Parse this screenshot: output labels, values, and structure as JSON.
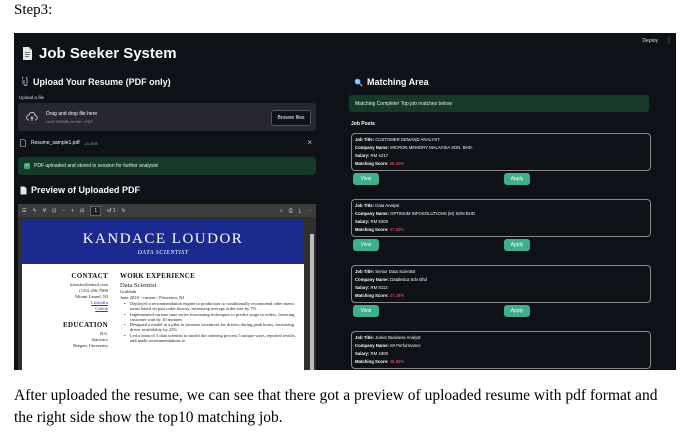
{
  "step_label": "Step3:",
  "app": {
    "deploy": "Deploy",
    "menu_glyph": "⋮",
    "title": "Job Seeker System",
    "upload": {
      "heading": "Upload Your Resume (PDF only)",
      "label": "Upload a file",
      "dropzone_title": "Drag and drop file here",
      "dropzone_limit": "Limit 200MB per file • PDF",
      "browse_label": "Browse files",
      "file_name": "Resume_sample1.pdf",
      "file_size": "21.2KB",
      "success": "PDF uploaded and stored in session for further analysis!"
    },
    "preview": {
      "heading": "Preview of Uploaded PDF",
      "page_current": "1",
      "page_total": "of 1",
      "resume": {
        "name": "KANDACE LOUDOR",
        "role": "DATA SCIENTIST",
        "contact_heading": "CONTACT",
        "contact": [
          "kloudor@email.com",
          "(123) 456-7890",
          "Mount Laurel, NJ"
        ],
        "links": [
          "LinkedIn",
          "Github"
        ],
        "education_heading": "EDUCATION",
        "education": [
          "B.S.",
          "Statistics",
          "Rutgers University"
        ],
        "work_heading": "WORK EXPERIENCE",
        "job_title": "Data Scientist",
        "company": "Grubhub",
        "period": "June 2018 - current  /  Princeton, NJ",
        "bullets": [
          "Deployed a recommendation engine to production to conditionally recommend other menu items based on past order history, increasing average order size by 7%",
          "Implemented various time series forecasting techniques to predict surge in orders, lowering customer wait by 10 minutes",
          "Designed a model in a pilot to increase incentives for drivers during peak hours, increasing driver availability by 22%",
          "Led a team of 3 data scientist to model the ordering process 5 unique ways, reported results, and made recommendations to"
        ]
      }
    },
    "matching": {
      "heading": "Matching Area",
      "status": "Matching Complete! Top job matches below:",
      "job_posts_label": "Job Posts",
      "view_label": "View",
      "apply_label": "Apply",
      "labels": {
        "title": "Job Title:",
        "company": "Company Name:",
        "salary": "Salary:",
        "score": "Matching Score:"
      },
      "jobs": [
        {
          "title": "CUSTOMER DEMAND ANALYST",
          "company": "MICRON MEMORY MALAYSIA SDN. BHD.",
          "salary": "RM 4217",
          "score": "55.20%"
        },
        {
          "title": "Data Analyst",
          "company": "OPTIMUM INFOSOLUTIONS (M) SDN BHD",
          "salary": "RM 8200",
          "score": "47.80%"
        },
        {
          "title": "Senior Data Scientist",
          "company": "Dataletica Sdn Bhd",
          "salary": "RM 8112",
          "score": "47.28%"
        },
        {
          "title": "Junior Business Analyst",
          "company": "MI Performance",
          "salary": "RM 4300",
          "score": "45.59%"
        }
      ]
    }
  },
  "caption": "After uploaded the resume, we can see that there got a preview of uploaded resume with pdf format and the right side show the top10 matching job."
}
